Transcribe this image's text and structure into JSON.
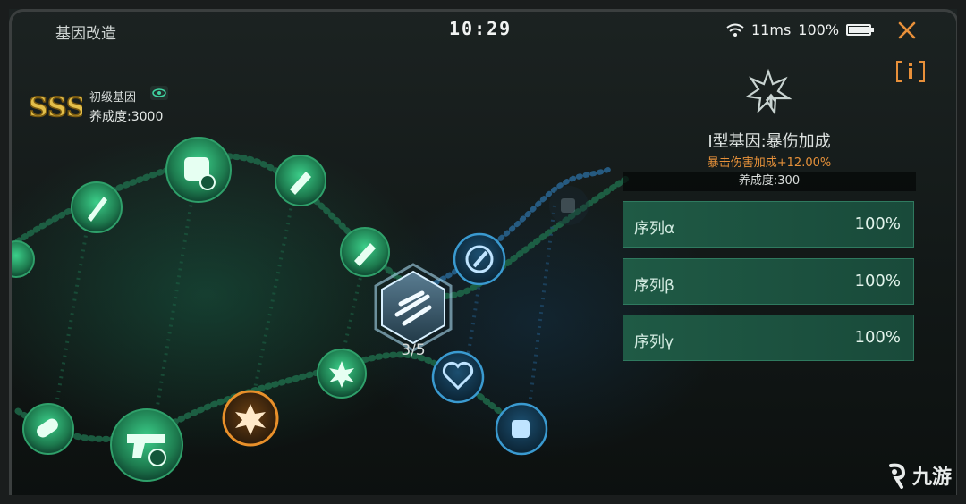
{
  "topbar": {
    "title": "基因改造",
    "clock": "10:29",
    "latency": "11ms",
    "battery_text": "100%",
    "battery_level": 1.0
  },
  "gene": {
    "rank": "SSS",
    "level_label": "初级基因",
    "score_label": "养成度:3000"
  },
  "helix": {
    "center_node": {
      "icon": "sword-slash-icon",
      "count": "3/5"
    },
    "nodes": [
      {
        "name": "node-dagger-boost",
        "icon": "dagger-icon",
        "state": "active"
      },
      {
        "name": "node-armor-level-1",
        "icon": "armor-icon",
        "state": "active"
      },
      {
        "name": "node-melee-guard",
        "icon": "blade-shield-icon",
        "state": "active"
      },
      {
        "name": "node-blade-boost",
        "icon": "blade-icon",
        "state": "active"
      },
      {
        "name": "node-crit-burst",
        "icon": "burst-icon",
        "state": "active"
      },
      {
        "name": "node-pill-guard",
        "icon": "capsule-icon",
        "state": "active"
      },
      {
        "name": "node-gun-level-1",
        "icon": "pistol-icon",
        "state": "active"
      },
      {
        "name": "node-crit-damage",
        "icon": "burst-icon",
        "state": "selected"
      },
      {
        "name": "node-attack-speed",
        "icon": "cycle-blade-icon",
        "state": "blue"
      },
      {
        "name": "node-heal-boost",
        "icon": "heart-icon",
        "state": "blue"
      },
      {
        "name": "node-fist-boost",
        "icon": "fist-icon",
        "state": "blue"
      },
      {
        "name": "node-fist-locked",
        "icon": "fist-icon",
        "state": "locked"
      }
    ]
  },
  "panel": {
    "skill_icon": "burst-icon",
    "skill_name": "I型基因:暴伤加成",
    "skill_effect": "暴击伤害加成+12.00%",
    "cost_label": "养成度:300",
    "sequences": [
      {
        "label": "序列α",
        "value": "100%"
      },
      {
        "label": "序列β",
        "value": "100%"
      },
      {
        "label": "序列γ",
        "value": "100%"
      }
    ]
  },
  "colors": {
    "node_green": "#2a8f5e",
    "node_blue": "#2a7fb0",
    "node_selected": "#e8902a",
    "accent_orange": "#e6913a"
  },
  "watermark": {
    "text": "九游"
  }
}
